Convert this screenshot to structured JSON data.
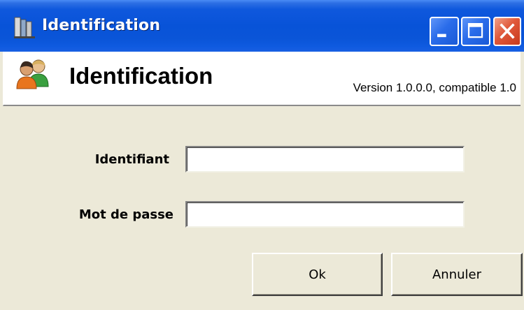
{
  "window": {
    "title": "Identification",
    "controls": {
      "minimize": "minimize-icon",
      "maximize": "maximize-icon",
      "close": "close-icon"
    }
  },
  "header": {
    "icon": "users-icon",
    "title": "Identification",
    "version": "Version 1.0.0.0, compatible 1.0"
  },
  "form": {
    "identifier_label": "Identifiant",
    "identifier_value": "",
    "password_label": "Mot de passe",
    "password_value": ""
  },
  "buttons": {
    "ok_label": "Ok",
    "cancel_label": "Annuler"
  },
  "colors": {
    "titlebar": "#0853d8",
    "close_button": "#e0583a",
    "dialog_background": "#ece9d8"
  }
}
